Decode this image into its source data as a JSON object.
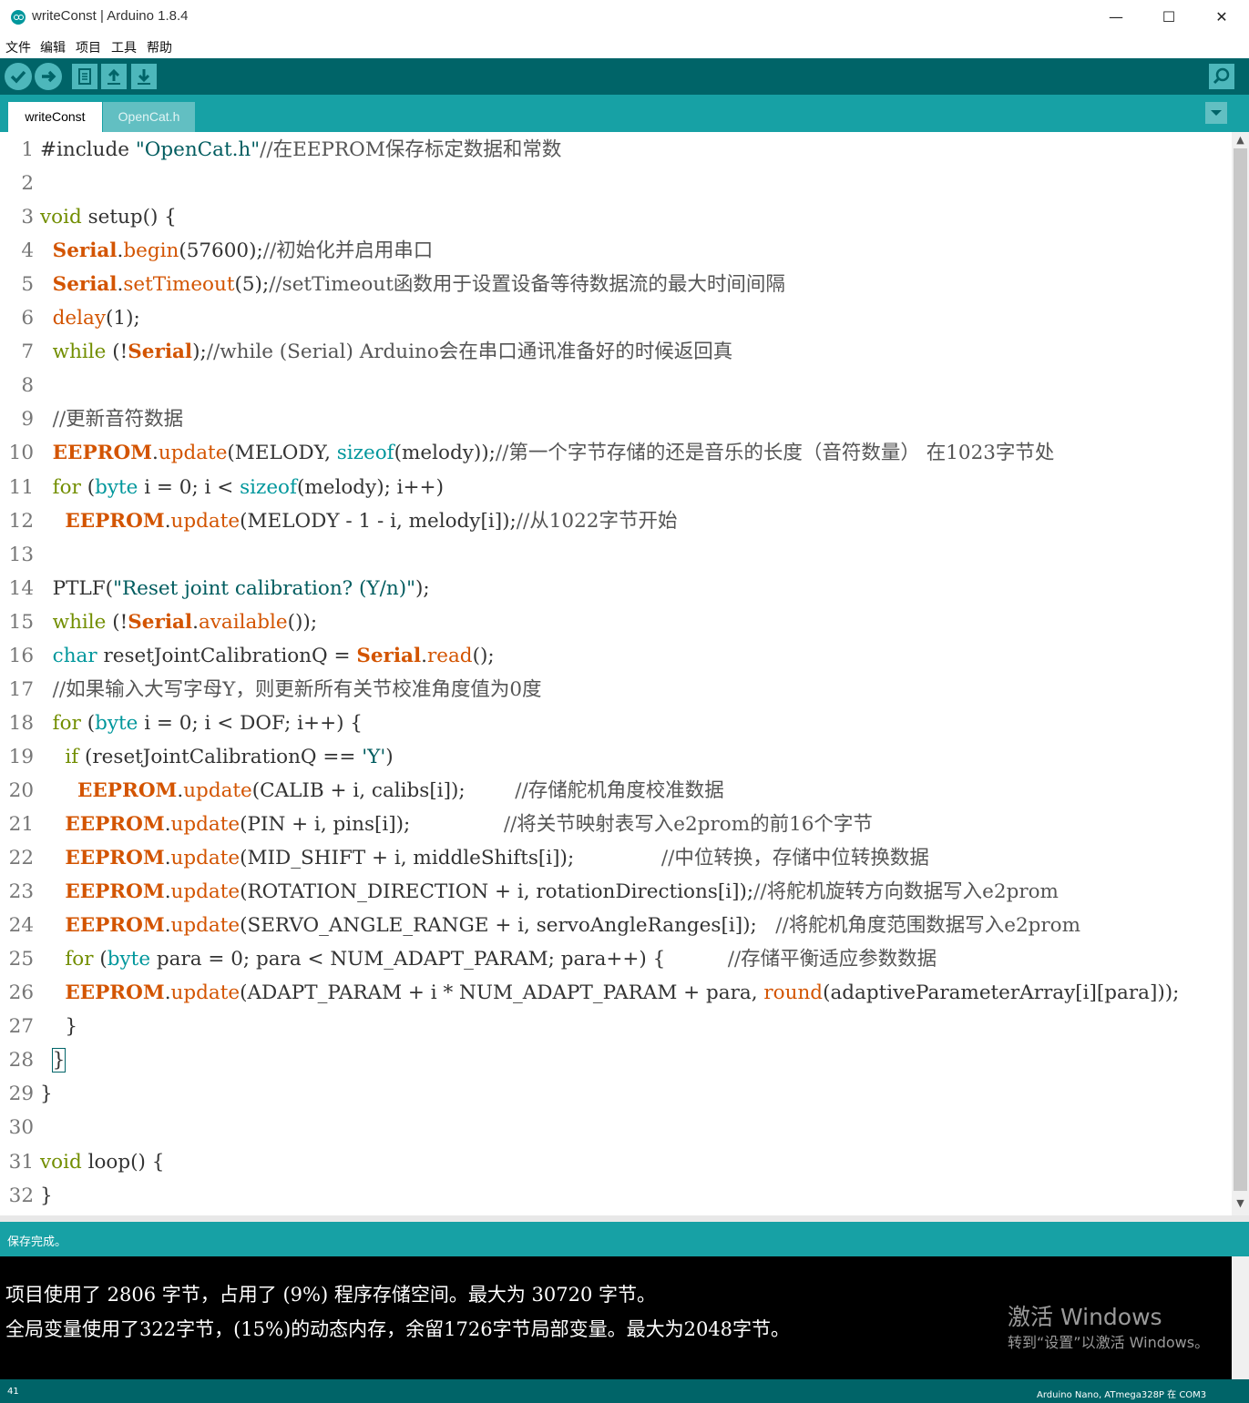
{
  "window": {
    "title": "writeConst | Arduino 1.8.4",
    "minimize": "—",
    "maximize": "☐",
    "close": "✕"
  },
  "menu": [
    "文件",
    "编辑",
    "项目",
    "工具",
    "帮助"
  ],
  "tabs": [
    {
      "label": "writeConst",
      "active": true
    },
    {
      "label": "OpenCat.h",
      "active": false
    }
  ],
  "code_lines": [
    "#include \"OpenCat.h\"//在EEPROM保存标定数据和常数",
    "",
    "void setup() {",
    "  Serial.begin(57600);//初始化并启用串口",
    "  Serial.setTimeout(5);//setTimeout函数用于设置设备等待数据流的最大时间间隔",
    "  delay(1);",
    "  while (!Serial);//while (Serial) Arduino会在串口通讯准备好的时候返回真",
    "",
    "  //更新音符数据",
    "  EEPROM.update(MELODY, sizeof(melody));//第一个字节存储的还是音乐的长度（音符数量） 在1023字节处",
    "  for (byte i = 0; i < sizeof(melody); i++)",
    "    EEPROM.update(MELODY - 1 - i, melody[i]);//从1022字节开始",
    "",
    "  PTLF(\"Reset joint calibration? (Y/n)\");",
    "  while (!Serial.available());",
    "  char resetJointCalibrationQ = Serial.read();",
    "  //如果输入大写字母Y，则更新所有关节校准角度值为0度",
    "  for (byte i = 0; i < DOF; i++) {",
    "    if (resetJointCalibrationQ == 'Y')",
    "      EEPROM.update(CALIB + i, calibs[i]);        //存储舵机角度校准数据",
    "    EEPROM.update(PIN + i, pins[i]);               //将关节映射表写入e2prom的前16个字节",
    "    EEPROM.update(MID_SHIFT + i, middleShifts[i]);              //中位转换，存储中位转换数据",
    "    EEPROM.update(ROTATION_DIRECTION + i, rotationDirections[i]);//将舵机旋转方向数据写入e2prom",
    "    EEPROM.update(SERVO_ANGLE_RANGE + i, servoAngleRanges[i]);   //将舵机角度范围数据写入e2prom",
    "    for (byte para = 0; para < NUM_ADAPT_PARAM; para++) {          //存储平衡适应参数数据",
    "    EEPROM.update(ADAPT_PARAM + i * NUM_ADAPT_PARAM + para, round(adaptiveParameterArray[i][para]));",
    "    }",
    "  }",
    "}",
    "",
    "void loop() {",
    "}"
  ],
  "status": "保存完成。",
  "console": [
    "项目使用了 2806 字节，占用了 (9%) 程序存储空间。最大为 30720 字节。",
    "全局变量使用了322字节，(15%)的动态内存，余留1726字节局部变量。最大为2048字节。"
  ],
  "watermark": {
    "line1": "激活 Windows",
    "line2": "转到“设置”以激活 Windows。"
  },
  "footer": {
    "line": "41",
    "board": "Arduino Nano, ATmega328P 在 COM3"
  },
  "colors": {
    "toolbar": "#006468",
    "tabbar": "#17a1a5",
    "keyword": "#728e00",
    "type": "#00979c",
    "object": "#d35400"
  }
}
